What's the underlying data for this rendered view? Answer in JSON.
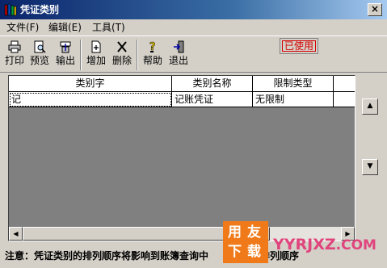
{
  "window": {
    "title": "凭证类别",
    "close_glyph": "×"
  },
  "menu": [
    {
      "label": "文件(F)"
    },
    {
      "label": "编辑(E)"
    },
    {
      "label": "工具(T)"
    }
  ],
  "toolbar": {
    "print": "打印",
    "preview": "预览",
    "export": "输出",
    "add": "增加",
    "delete": "删除",
    "help": "帮助",
    "exit": "退出"
  },
  "status_badge": "已使用",
  "table": {
    "columns": [
      "类别字",
      "类别名称",
      "限制类型"
    ],
    "rows": [
      [
        "记",
        "记账凭证",
        "无限制"
      ]
    ]
  },
  "note": "注意：凭证类别的排列顺序将影响到账簿查询中",
  "note_tail": "的排列顺序",
  "watermark": {
    "logo_chars": [
      "用",
      "友",
      "下",
      "载"
    ],
    "url": "YYRJXZ",
    "url_suffix": ".COM"
  },
  "colors": {
    "titlebar_start": "#0a246a",
    "badge_red": "#d40000",
    "watermark_orange": "#f07a1a",
    "watermark_pink": "#e0447c"
  }
}
